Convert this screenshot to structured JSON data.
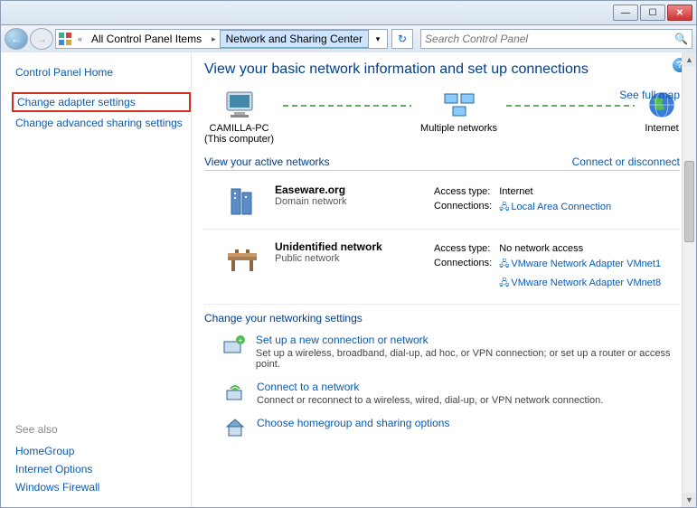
{
  "titlebar": {
    "min": "—",
    "max": "☐",
    "close": "✕"
  },
  "nav": {
    "back": "←",
    "fwd": "→",
    "crumb1": "All Control Panel Items",
    "crumb2": "Network and Sharing Center",
    "search_placeholder": "Search Control Panel"
  },
  "sidebar": {
    "home": "Control Panel Home",
    "adapter": "Change adapter settings",
    "advanced": "Change advanced sharing settings",
    "see_also": "See also",
    "homegroup": "HomeGroup",
    "inetopts": "Internet Options",
    "firewall": "Windows Firewall"
  },
  "main": {
    "title": "View your basic network information and set up connections",
    "seefull": "See full map",
    "node1": "CAMILLA-PC",
    "node1sub": "(This computer)",
    "node2": "Multiple networks",
    "node3": "Internet",
    "active_h": "View your active networks",
    "connect_link": "Connect or disconnect",
    "net1": {
      "name": "Easeware.org",
      "type": "Domain network",
      "access_l": "Access type:",
      "access_v": "Internet",
      "conn_l": "Connections:",
      "conn_v": "Local Area Connection"
    },
    "net2": {
      "name": "Unidentified network",
      "type": "Public network",
      "access_l": "Access type:",
      "access_v": "No network access",
      "conn_l": "Connections:",
      "conn_v1": "VMware Network Adapter VMnet1",
      "conn_v2": "VMware Network Adapter VMnet8"
    },
    "settings_h": "Change your networking settings",
    "s1": {
      "t": "Set up a new connection or network",
      "d": "Set up a wireless, broadband, dial-up, ad hoc, or VPN connection; or set up a router or access point."
    },
    "s2": {
      "t": "Connect to a network",
      "d": "Connect or reconnect to a wireless, wired, dial-up, or VPN network connection."
    },
    "s3": {
      "t": "Choose homegroup and sharing options",
      "d": ""
    }
  }
}
